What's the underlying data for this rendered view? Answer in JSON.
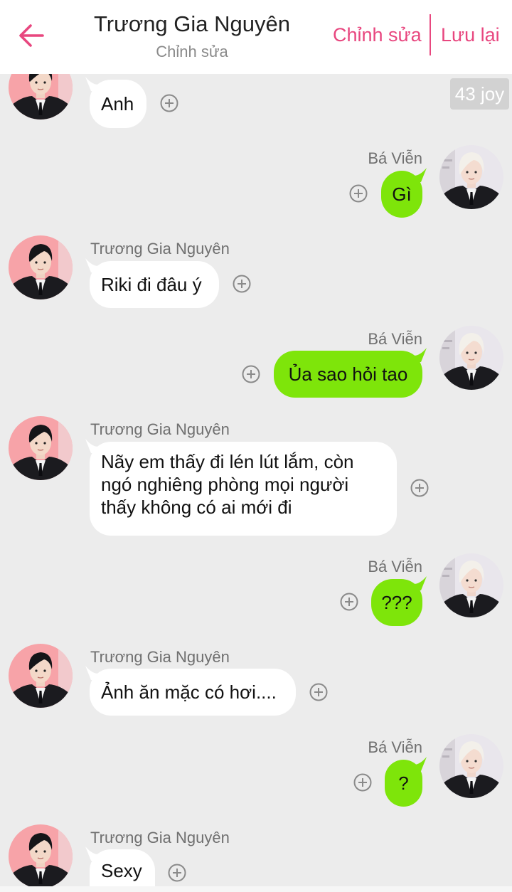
{
  "header": {
    "title": "Trương Gia Nguyên",
    "subtitle": "Chỉnh sửa",
    "edit_label": "Chỉnh sửa",
    "save_label": "Lưu lại",
    "accent": "#e8477f",
    "back_icon": "arrow-left-icon"
  },
  "badge": "43 joy",
  "colors": {
    "background": "#ececec",
    "incoming_bubble": "#ffffff",
    "outgoing_bubble": "#7ee50a",
    "sender_text": "#6f6f6f"
  },
  "participants": {
    "left": "Trương Gia Nguyên",
    "right": "Bá Viễn"
  },
  "messages": [
    {
      "side": "left",
      "sender": "",
      "text": "Anh"
    },
    {
      "side": "right",
      "sender": "Bá Viễn",
      "text": "Gì"
    },
    {
      "side": "left",
      "sender": "Trương Gia Nguyên",
      "text": "Riki đi đâu ý"
    },
    {
      "side": "right",
      "sender": "Bá Viễn",
      "text": "Ủa sao hỏi tao"
    },
    {
      "side": "left",
      "sender": "Trương Gia Nguyên",
      "lines": [
        "Nãy em thấy đi lén lút lắm, còn",
        "ngó nghiêng phòng mọi người",
        "thấy không có ai mới đi"
      ]
    },
    {
      "side": "right",
      "sender": "Bá Viễn",
      "text": "???"
    },
    {
      "side": "left",
      "sender": "Trương Gia Nguyên",
      "text": "Ảnh ăn mặc có hơi...."
    },
    {
      "side": "right",
      "sender": "Bá Viễn",
      "text": "?"
    },
    {
      "side": "left",
      "sender": "Trương Gia Nguyên",
      "text": "Sexy"
    }
  ],
  "icons": {
    "add": "plus-circle-icon",
    "avatar_left": "avatar-truong-gia-nguyen",
    "avatar_right": "avatar-ba-vien"
  }
}
